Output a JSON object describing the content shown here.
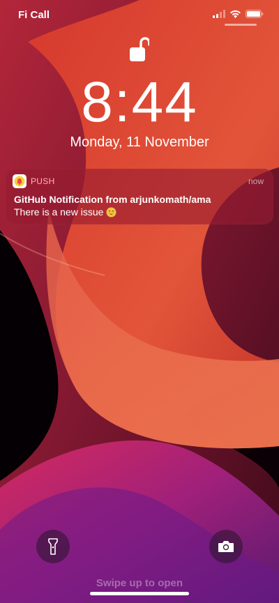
{
  "status_bar": {
    "carrier": "Fi Call"
  },
  "lock_screen": {
    "time": "8:44",
    "date": "Monday, 11 November"
  },
  "notification": {
    "app_name": "PUSH",
    "timestamp": "now",
    "title": "GitHub Notification from arjunkomath/ama",
    "body": "There is a new issue"
  },
  "footer": {
    "swipe_hint": "Swipe up to open"
  },
  "icons": {
    "lock": "unlocked-padlock-icon",
    "flashlight": "flashlight-icon",
    "camera": "camera-icon",
    "app": "bell-icon",
    "emoji": "grinning-sweat-emoji"
  },
  "colors": {
    "app_name": "#ffb3bd",
    "notification_bg": "#961c30"
  }
}
